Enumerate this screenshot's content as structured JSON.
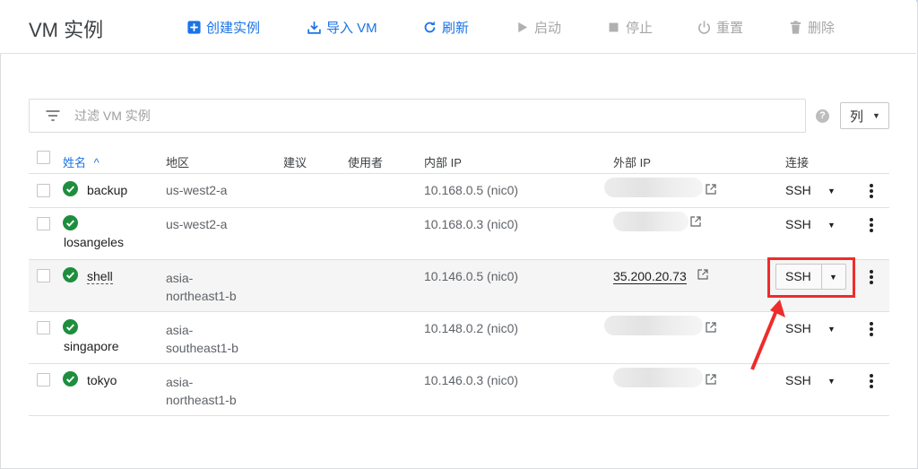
{
  "header": {
    "title": "VM 实例",
    "toolbar": [
      {
        "label": "创建实例",
        "icon": "add-box-icon",
        "enabled": true
      },
      {
        "label": "导入 VM",
        "icon": "download-icon",
        "enabled": true
      },
      {
        "label": "刷新",
        "icon": "refresh-icon",
        "enabled": true
      },
      {
        "label": "启动",
        "icon": "play-icon",
        "enabled": false
      },
      {
        "label": "停止",
        "icon": "stop-icon",
        "enabled": false
      },
      {
        "label": "重置",
        "icon": "power-icon",
        "enabled": false
      },
      {
        "label": "删除",
        "icon": "trash-icon",
        "enabled": false
      }
    ]
  },
  "filter": {
    "placeholder": "过滤 VM 实例",
    "icon": "filter-list-icon"
  },
  "columns_button": {
    "label": "列"
  },
  "table": {
    "headers": {
      "name": "姓名",
      "sort_indicator": "^",
      "zone": "地区",
      "recommendation": "建议",
      "in_use_by": "使用者",
      "internal_ip": "内部 IP",
      "external_ip": "外部 IP",
      "connect": "连接"
    },
    "rows": [
      {
        "name": "backup",
        "zone": "us-west2-a",
        "internal_ip": "10.168.0.5 (nic0)",
        "external_ip": "",
        "connect": "SSH",
        "status": "running"
      },
      {
        "name": "losangeles",
        "zone": "us-west2-a",
        "internal_ip": "10.168.0.3 (nic0)",
        "external_ip": "",
        "connect": "SSH",
        "status": "running"
      },
      {
        "name": "shell",
        "zone": "asia-northeast1-b",
        "internal_ip": "10.146.0.5 (nic0)",
        "external_ip": "35.200.20.73",
        "connect": "SSH",
        "status": "running",
        "highlighted": true
      },
      {
        "name": "singapore",
        "zone": "asia-southeast1-b",
        "internal_ip": "10.148.0.2 (nic0)",
        "external_ip": "",
        "connect": "SSH",
        "status": "running"
      },
      {
        "name": "tokyo",
        "zone": "asia-northeast1-b",
        "internal_ip": "10.146.0.3 (nic0)",
        "external_ip": "",
        "connect": "SSH",
        "status": "running"
      }
    ]
  },
  "colors": {
    "accent": "#1a73e8",
    "status_ok": "#1e8e3e",
    "annotation": "#ee2c2c",
    "disabled": "#a6a6a6"
  }
}
